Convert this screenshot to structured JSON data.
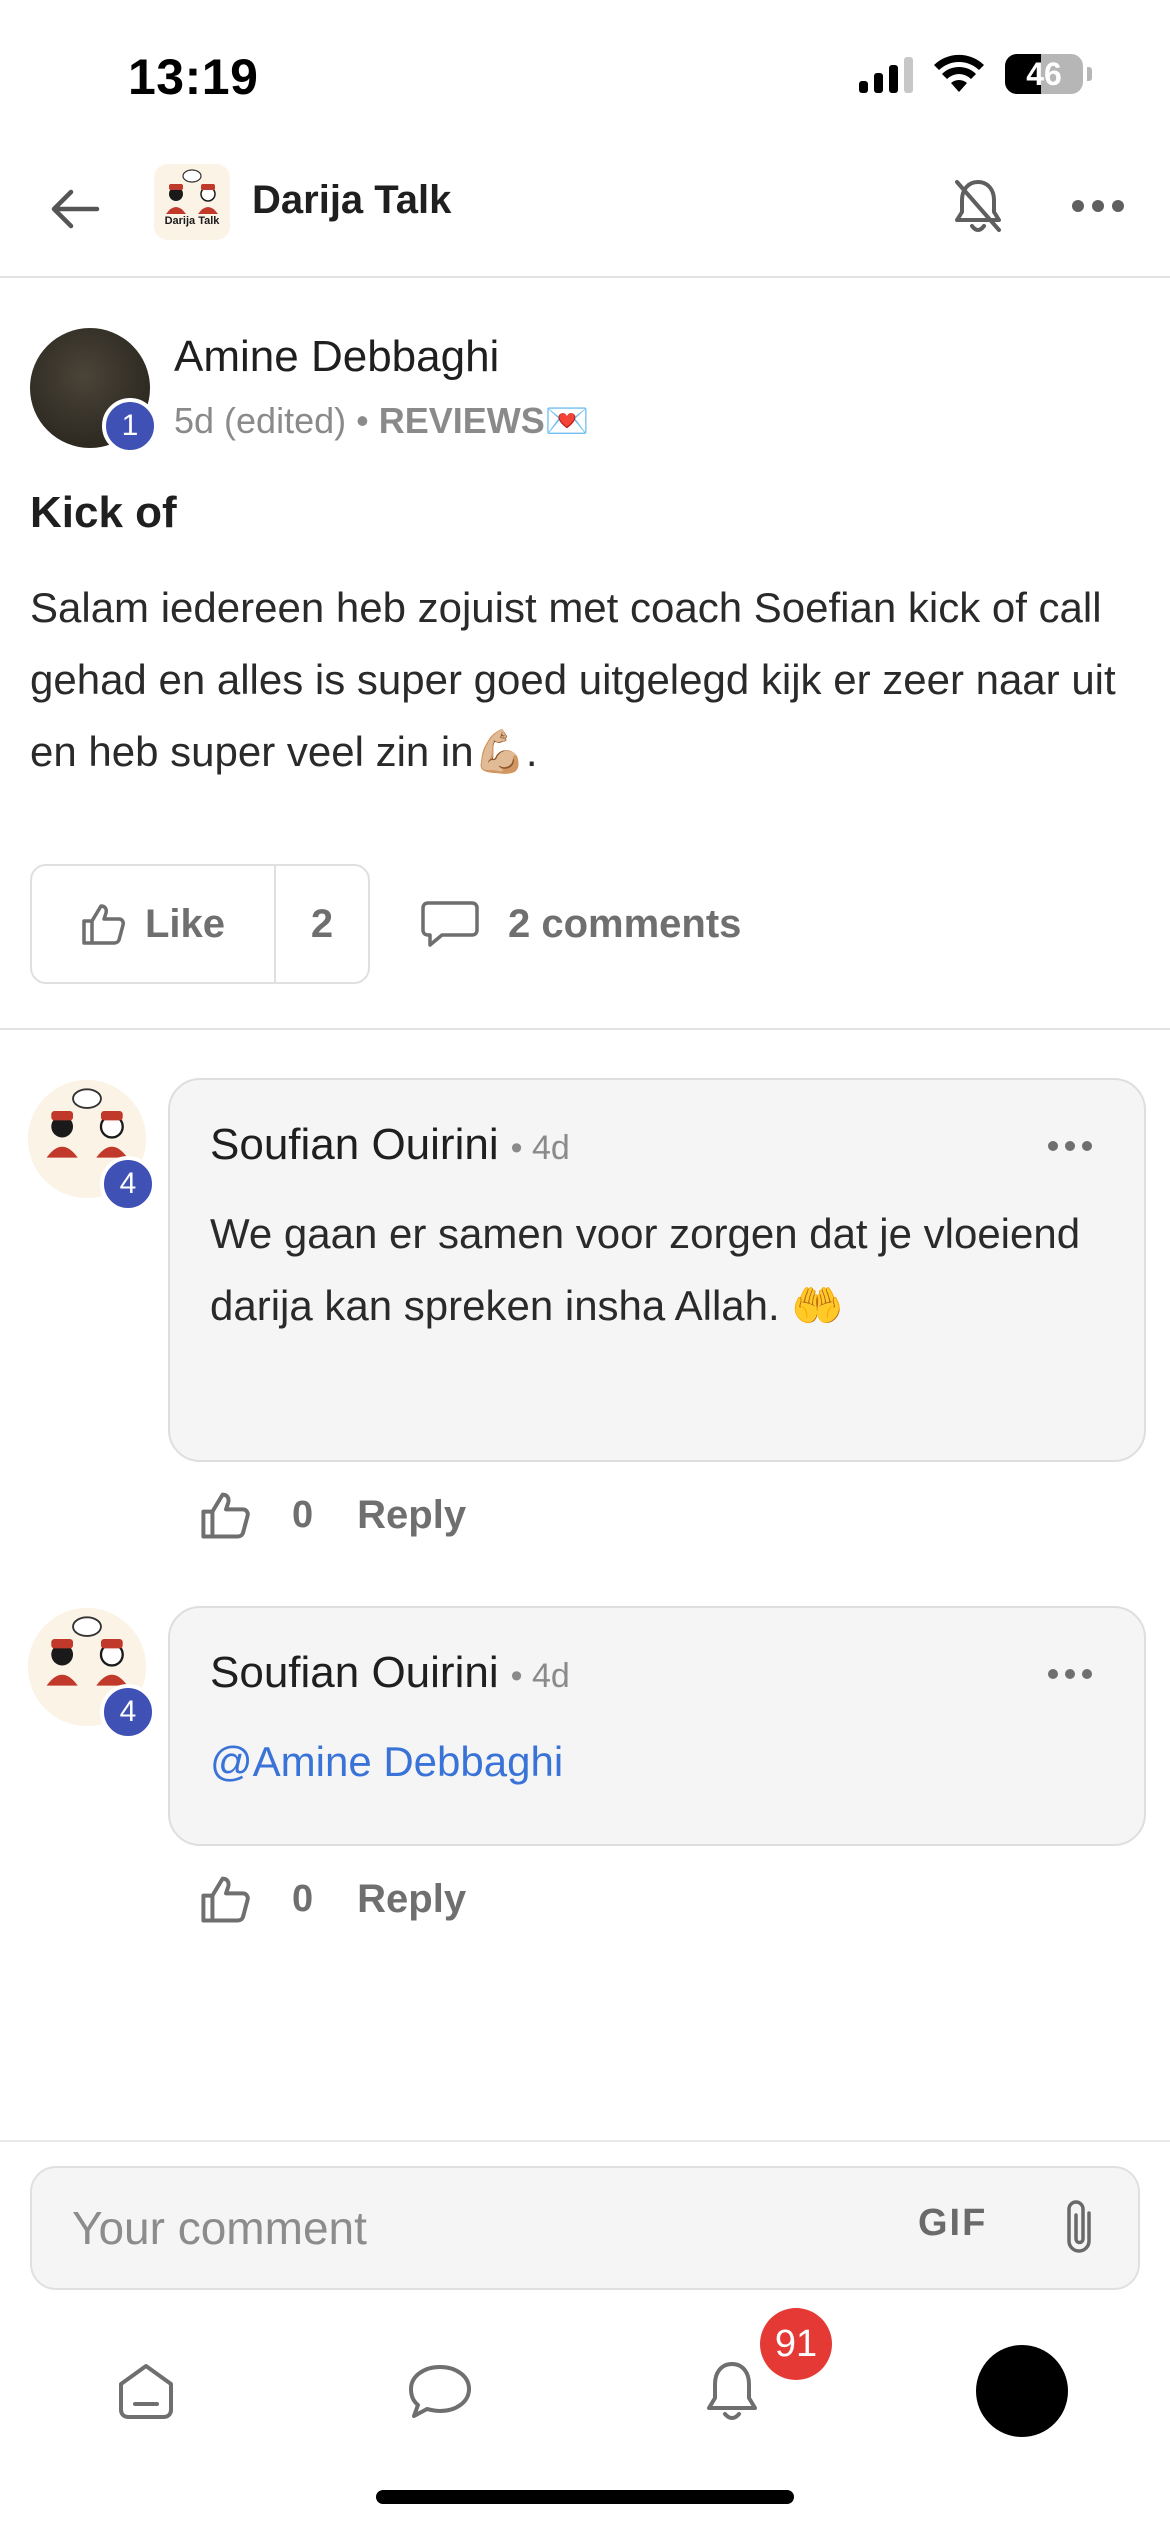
{
  "status_bar": {
    "time": "13:19",
    "battery": "46",
    "battery_level": 0.46
  },
  "header": {
    "title": "Darija Talk",
    "logo_text": "Darija Talk"
  },
  "post": {
    "author": "Amine Debbaghi",
    "author_level": "1",
    "time": "5d (edited)",
    "separator": "•",
    "category": "REVIEWS",
    "category_emoji": "💌",
    "title": "Kick of",
    "body": "Salam iedereen heb zojuist met coach Soefian kick of call gehad en alles is super goed uitgelegd kijk er zeer naar uit en heb super veel zin in💪🏼.",
    "like_label": "Like",
    "like_count": "2",
    "comments_label": "2 comments"
  },
  "comments": [
    {
      "author": "Soufian Ouirini",
      "level": "4",
      "time": "• 4d",
      "text": "We gaan er samen voor zorgen dat je vloeiend darija kan spreken insha Allah. 🤲",
      "like_count": "0",
      "reply_label": "Reply"
    },
    {
      "author": "Soufian Ouirini",
      "level": "4",
      "time": "• 4d",
      "mention": "@Amine Debbaghi",
      "like_count": "0",
      "reply_label": "Reply"
    }
  ],
  "composer": {
    "placeholder": "Your comment",
    "gif_label": "GIF"
  },
  "tab_bar": {
    "notification_count": "91"
  },
  "colors": {
    "accent": "#3f51b5",
    "mention": "#3a73d8",
    "badge": "#e53935"
  },
  "icons": [
    "back-arrow-icon",
    "bell-off-icon",
    "more-horizontal-icon",
    "thumbs-up-icon",
    "comment-icon",
    "attach-icon",
    "home-icon",
    "chat-icon",
    "bell-icon"
  ]
}
